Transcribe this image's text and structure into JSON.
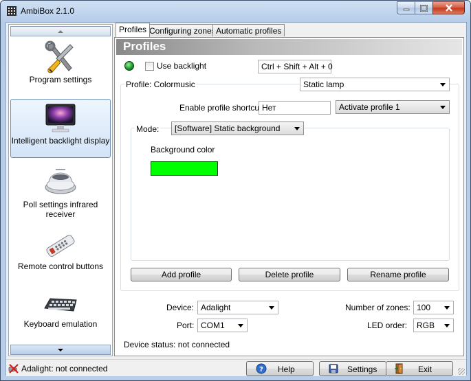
{
  "window": {
    "title": "AmbiBox 2.1.0",
    "icons": {
      "app": "ambibox-grid-icon",
      "minimize": "minimize-icon",
      "maximize": "maximize-icon",
      "close": "close-icon"
    }
  },
  "sidebar": {
    "items": [
      {
        "label": "Program settings",
        "icon": "wrench-screwdriver-icon"
      },
      {
        "label": "Intelligent backlight display",
        "icon": "monitor-icon",
        "active": true
      },
      {
        "label": "Poll settings infrared receiver",
        "icon": "ir-receiver-icon"
      },
      {
        "label": "Remote control buttons",
        "icon": "remote-control-icon"
      },
      {
        "label": "Keyboard emulation",
        "icon": "keyboard-icon"
      }
    ]
  },
  "tabs": [
    {
      "label": "Profiles",
      "active": true
    },
    {
      "label": "Configuring zones"
    },
    {
      "label": "Automatic profiles"
    }
  ],
  "profiles": {
    "header": "Profiles",
    "use_backlight_label": "Use backlight",
    "use_backlight_checked": false,
    "backlight_shortcut": "Ctrl + Shift + Alt + 0",
    "profile_label": "Profile: Colormusic",
    "profile_select": "Static lamp",
    "enable_shortcut_label": "Enable profile shortcut:",
    "enable_shortcut_value": "Нет",
    "activate_select": "Activate profile 1",
    "mode_label": "Mode:",
    "mode_select": "[Software] Static background",
    "background_color_label": "Background color",
    "background_color": "#00ff00",
    "add_button": "Add profile",
    "delete_button": "Delete profile",
    "rename_button": "Rename profile"
  },
  "device": {
    "device_label": "Device:",
    "device_value": "Adalight",
    "port_label": "Port:",
    "port_value": "COM1",
    "zones_label": "Number of zones:",
    "zones_value": "100",
    "led_order_label": "LED order:",
    "led_order_value": "RGB",
    "status": "Device status: not connected"
  },
  "statusbar": {
    "status_text": "Adalight: not connected",
    "help_label": "Help",
    "settings_label": "Settings",
    "exit_label": "Exit"
  },
  "colors": {
    "accent_green": "#00ff00",
    "led_green": "#1a9a2a"
  }
}
